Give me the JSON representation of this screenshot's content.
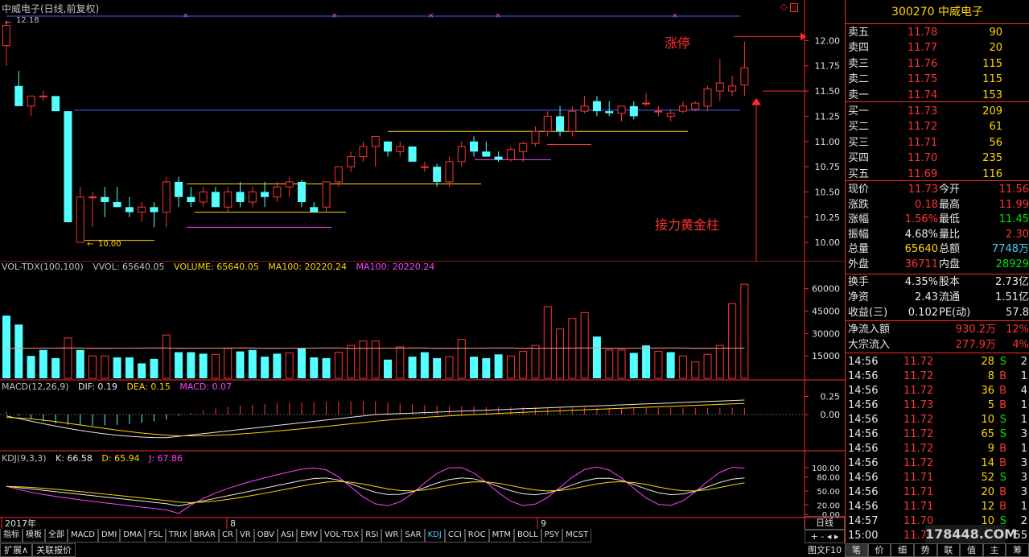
{
  "window": {
    "title": "中威电子(日线,前复权)",
    "stock_code": "300270",
    "stock_name": "中威电子"
  },
  "annotations": {
    "limit_up": "涨停",
    "relay": "接力黄金柱",
    "high_marker": "12.18",
    "low_marker": "10.00"
  },
  "chart_data": [
    {
      "type": "candlestick",
      "title": "中威电子(日线,前复权)",
      "ylim": [
        9.85,
        12.25
      ],
      "y_ticks": [
        "12.00",
        "11.75",
        "11.50",
        "11.25",
        "11.00",
        "10.75",
        "10.50",
        "10.25",
        "10.00"
      ],
      "x_labels": [
        "2017年",
        "8",
        "9"
      ],
      "candles_ohlc": [
        [
          11.95,
          12.18,
          11.75,
          12.15
        ],
        [
          11.55,
          11.7,
          11.35,
          11.35
        ],
        [
          11.35,
          11.45,
          11.25,
          11.45
        ],
        [
          11.45,
          11.5,
          11.4,
          11.45
        ],
        [
          11.45,
          11.45,
          11.3,
          11.3
        ],
        [
          11.3,
          11.3,
          10.2,
          10.2
        ],
        [
          10.0,
          10.55,
          10.0,
          10.45
        ],
        [
          10.45,
          10.5,
          10.15,
          10.45
        ],
        [
          10.45,
          10.55,
          10.25,
          10.4
        ],
        [
          10.4,
          10.55,
          10.35,
          10.35
        ],
        [
          10.35,
          10.45,
          10.25,
          10.3
        ],
        [
          10.3,
          10.4,
          10.2,
          10.35
        ],
        [
          10.35,
          10.4,
          10.15,
          10.3
        ],
        [
          10.3,
          10.65,
          10.15,
          10.6
        ],
        [
          10.6,
          10.65,
          10.35,
          10.45
        ],
        [
          10.45,
          10.55,
          10.35,
          10.4
        ],
        [
          10.4,
          10.55,
          10.35,
          10.5
        ],
        [
          10.5,
          10.55,
          10.35,
          10.35
        ],
        [
          10.35,
          10.55,
          10.3,
          10.5
        ],
        [
          10.5,
          10.6,
          10.35,
          10.4
        ],
        [
          10.4,
          10.55,
          10.35,
          10.5
        ],
        [
          10.5,
          10.6,
          10.35,
          10.45
        ],
        [
          10.45,
          10.6,
          10.4,
          10.55
        ],
        [
          10.55,
          10.65,
          10.45,
          10.6
        ],
        [
          10.6,
          10.62,
          10.35,
          10.4
        ],
        [
          10.35,
          10.4,
          10.3,
          10.3
        ],
        [
          10.35,
          10.6,
          10.3,
          10.6
        ],
        [
          10.6,
          10.75,
          10.55,
          10.75
        ],
        [
          10.75,
          10.9,
          10.7,
          10.85
        ],
        [
          10.85,
          11.0,
          10.8,
          10.95
        ],
        [
          10.95,
          11.05,
          10.75,
          11.05
        ],
        [
          11.0,
          11.0,
          10.85,
          10.9
        ],
        [
          10.9,
          11.0,
          10.85,
          10.95
        ],
        [
          10.95,
          10.95,
          10.8,
          10.8
        ],
        [
          10.75,
          10.8,
          10.7,
          10.75
        ],
        [
          10.75,
          10.78,
          10.55,
          10.6
        ],
        [
          10.6,
          10.85,
          10.55,
          10.8
        ],
        [
          10.8,
          11.0,
          10.75,
          10.95
        ],
        [
          11.0,
          11.05,
          10.85,
          10.9
        ],
        [
          10.9,
          11.0,
          10.85,
          10.85
        ],
        [
          10.85,
          10.9,
          10.8,
          10.82
        ],
        [
          10.82,
          10.95,
          10.8,
          10.92
        ],
        [
          10.9,
          11.0,
          10.8,
          10.98
        ],
        [
          10.98,
          11.15,
          10.95,
          11.1
        ],
        [
          11.1,
          11.3,
          11.05,
          11.25
        ],
        [
          11.25,
          11.35,
          11.05,
          11.1
        ],
        [
          11.1,
          11.35,
          11.05,
          11.3
        ],
        [
          11.3,
          11.45,
          11.28,
          11.35
        ],
        [
          11.4,
          11.45,
          11.25,
          11.3
        ],
        [
          11.3,
          11.4,
          11.25,
          11.28
        ],
        [
          11.28,
          11.35,
          11.2,
          11.35
        ],
        [
          11.35,
          11.4,
          11.22,
          11.25
        ],
        [
          11.38,
          11.48,
          11.35,
          11.38
        ],
        [
          11.3,
          11.35,
          11.25,
          11.3
        ],
        [
          11.25,
          11.32,
          11.2,
          11.28
        ],
        [
          11.3,
          11.4,
          11.28,
          11.35
        ],
        [
          11.32,
          11.4,
          11.3,
          11.38
        ],
        [
          11.35,
          11.55,
          11.3,
          11.52
        ],
        [
          11.5,
          11.82,
          11.4,
          11.58
        ],
        [
          11.5,
          11.65,
          11.45,
          11.55
        ],
        [
          11.56,
          11.99,
          11.45,
          11.73
        ]
      ]
    },
    {
      "type": "bar",
      "title": "VOL-TDX(100,100)",
      "series_labels": [
        "VVOL: 65640.05",
        "VOLUME: 65640.05",
        "MA100: 20220.24",
        "MA100: 20220.24"
      ],
      "y_ticks": [
        "60000",
        "45000",
        "30000",
        "15000"
      ],
      "ylim": [
        0,
        69000
      ],
      "values": [
        42000,
        36000,
        15000,
        19000,
        13500,
        27000,
        19000,
        15000,
        15000,
        14000,
        14000,
        10000,
        13000,
        29000,
        17500,
        17500,
        16500,
        16000,
        20000,
        18000,
        19000,
        14500,
        16500,
        17000,
        20000,
        14000,
        13500,
        17500,
        22000,
        25000,
        25000,
        12500,
        21000,
        14500,
        17500,
        13500,
        14500,
        26000,
        14500,
        13500,
        16000,
        15000,
        18000,
        22000,
        48000,
        33000,
        40000,
        44000,
        28000,
        19000,
        19000,
        17000,
        22000,
        18000,
        17500,
        15000,
        11000,
        16000,
        22000,
        50000,
        63000
      ],
      "rising": [
        false,
        false,
        false,
        false,
        false,
        true,
        false,
        true,
        true,
        false,
        false,
        false,
        false,
        true,
        false,
        false,
        false,
        true,
        true,
        false,
        false,
        false,
        false,
        true,
        false,
        false,
        false,
        true,
        true,
        true,
        true,
        false,
        true,
        false,
        false,
        false,
        true,
        true,
        false,
        false,
        false,
        true,
        true,
        true,
        true,
        true,
        true,
        true,
        false,
        true,
        true,
        false,
        false,
        true,
        false,
        true,
        true,
        true,
        true,
        true,
        true
      ]
    },
    {
      "type": "line",
      "title": "MACD(12,26,9)",
      "series_labels": [
        "DIF: 0.19",
        "DEA: 0.15",
        "MACD: 0.07"
      ],
      "y_ticks": [
        "0.25",
        "0.00"
      ]
    },
    {
      "type": "line",
      "title": "KDJ(9,3,3)",
      "series_labels": [
        "K: 66.58",
        "D: 65.94",
        "J: 67.86"
      ],
      "y_ticks": [
        "100.00",
        "80.00",
        "50.00",
        "20.00",
        "0.00"
      ]
    }
  ],
  "chart_labels": {
    "vol_title": "VOL-TDX(100,100)",
    "vol_vvol": "VVOL: 65640.05",
    "vol_volume": "VOLUME: 65640.05",
    "vol_ma1": "MA100: 20220.24",
    "vol_ma2": "MA100: 20220.24",
    "macd_title": "MACD(12,26,9)",
    "macd_dif": "DIF: 0.19",
    "macd_dea": "DEA: 0.15",
    "macd_macd": "MACD: 0.07",
    "kdj_title": "KDJ(9,3,3)",
    "kdj_k": "K: 66.58",
    "kdj_d": "D: 65.94",
    "kdj_j": "J: 67.86"
  },
  "indicator_tabs": [
    "指标",
    "模板",
    "全部",
    "MACD",
    "DMI",
    "DMA",
    "FSL",
    "TRIX",
    "BRAR",
    "CR",
    "VR",
    "OBV",
    "ASI",
    "EMV",
    "VOL-TDX",
    "RSI",
    "WR",
    "SAR",
    "KDJ",
    "CCI",
    "ROC",
    "MTM",
    "BOLL",
    "PSY",
    "MCST"
  ],
  "active_tab": "KDJ",
  "bottom_tabs": [
    "扩展∧",
    "关联报价"
  ],
  "order_book": {
    "asks": [
      {
        "label": "卖五",
        "price": "11.78",
        "vol": "90"
      },
      {
        "label": "卖四",
        "price": "11.77",
        "vol": "20"
      },
      {
        "label": "卖三",
        "price": "11.76",
        "vol": "115"
      },
      {
        "label": "卖二",
        "price": "11.75",
        "vol": "115"
      },
      {
        "label": "卖一",
        "price": "11.74",
        "vol": "153"
      }
    ],
    "bids": [
      {
        "label": "买一",
        "price": "11.73",
        "vol": "209"
      },
      {
        "label": "买二",
        "price": "11.72",
        "vol": "61"
      },
      {
        "label": "买三",
        "price": "11.71",
        "vol": "56"
      },
      {
        "label": "买四",
        "price": "11.70",
        "vol": "235"
      },
      {
        "label": "买五",
        "price": "11.69",
        "vol": "116"
      }
    ]
  },
  "quote": {
    "rows": [
      {
        "l1": "现价",
        "v1": "11.73",
        "l2": "今开",
        "v2": "11.56",
        "c1": "red",
        "c2": "red"
      },
      {
        "l1": "涨跌",
        "v1": "0.18",
        "l2": "最高",
        "v2": "11.99",
        "c1": "red",
        "c2": "red"
      },
      {
        "l1": "涨幅",
        "v1": "1.56%",
        "l2": "最低",
        "v2": "11.45",
        "c1": "red",
        "c2": "green"
      },
      {
        "l1": "振幅",
        "v1": "4.68%",
        "l2": "量比",
        "v2": "2.30",
        "c1": "white",
        "c2": "red"
      },
      {
        "l1": "总量",
        "v1": "65640",
        "l2": "总额",
        "v2": "7748万",
        "c1": "yellow",
        "c2": "cyan"
      },
      {
        "l1": "外盘",
        "v1": "36711",
        "l2": "内盘",
        "v2": "28929",
        "c1": "red",
        "c2": "green"
      }
    ],
    "rows2": [
      {
        "l1": "换手",
        "v1": "4.35%",
        "l2": "股本",
        "v2": "2.73亿"
      },
      {
        "l1": "净资",
        "v1": "2.43",
        "l2": "流通",
        "v2": "1.51亿"
      },
      {
        "l1": "收益(三)",
        "v1": "0.102",
        "l2": "PE(动)",
        "v2": "57.8"
      }
    ],
    "flow": [
      {
        "label": "净流入额",
        "value": "930.2万",
        "pct": "12%"
      },
      {
        "label": "大宗流入",
        "value": "277.9万",
        "pct": "4%"
      }
    ]
  },
  "trades": [
    {
      "time": "14:56",
      "price": "11.72",
      "vol": "28",
      "side": "S",
      "n": "2"
    },
    {
      "time": "14:56",
      "price": "11.72",
      "vol": "8",
      "side": "B",
      "n": "1"
    },
    {
      "time": "14:56",
      "price": "11.72",
      "vol": "36",
      "side": "B",
      "n": "4"
    },
    {
      "time": "14:56",
      "price": "11.73",
      "vol": "5",
      "side": "B",
      "n": "1"
    },
    {
      "time": "14:56",
      "price": "11.72",
      "vol": "10",
      "side": "S",
      "n": "1"
    },
    {
      "time": "14:56",
      "price": "11.72",
      "vol": "65",
      "side": "S",
      "n": "3"
    },
    {
      "time": "14:56",
      "price": "11.72",
      "vol": "9",
      "side": "B",
      "n": "1"
    },
    {
      "time": "14:56",
      "price": "11.72",
      "vol": "14",
      "side": "B",
      "n": "3"
    },
    {
      "time": "14:56",
      "price": "11.71",
      "vol": "52",
      "side": "S",
      "n": "3"
    },
    {
      "time": "14:56",
      "price": "11.71",
      "vol": "20",
      "side": "B",
      "n": "3"
    },
    {
      "time": "14:56",
      "price": "11.71",
      "vol": "12",
      "side": "B",
      "n": "1"
    },
    {
      "time": "14:57",
      "price": "11.70",
      "vol": "10",
      "side": "S",
      "n": "2"
    },
    {
      "time": "15:00",
      "price": "11.73",
      "vol": "1212",
      "side": "B",
      "n": "55"
    }
  ],
  "period_label": "日线",
  "right_tabs": [
    "笔",
    "价",
    "细",
    "势",
    "联",
    "值",
    "主",
    "筹"
  ],
  "active_right_tab": "笔",
  "status_label": "图文F10",
  "watermark": "178448.COM",
  "colors": {
    "up": "#ff3333",
    "down": "#54ffff",
    "frame": "#ff2a2a",
    "yellow": "#ffd700",
    "magenta": "#ff40ff"
  }
}
